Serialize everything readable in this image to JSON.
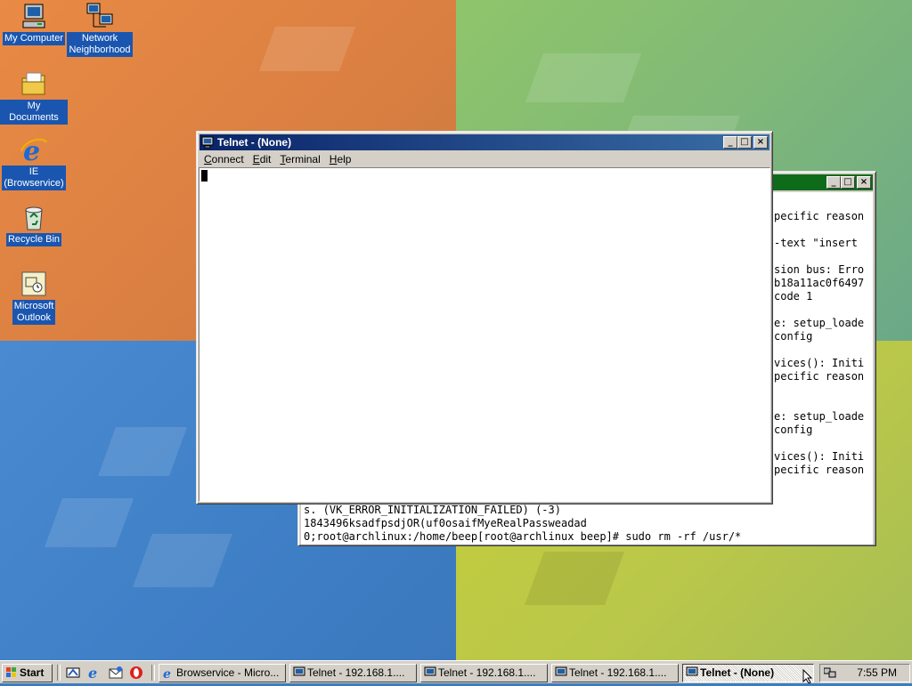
{
  "desktop": {
    "icons": [
      {
        "label_line1": "My Computer",
        "label_line2": ""
      },
      {
        "label_line1": "Network",
        "label_line2": "Neighborhood"
      },
      {
        "label_line1": "My Documents",
        "label_line2": ""
      },
      {
        "label_line1": "IE",
        "label_line2": "(Browservice)"
      },
      {
        "label_line1": "Recycle Bin",
        "label_line2": ""
      },
      {
        "label_line1": "Microsoft",
        "label_line2": "Outlook"
      }
    ]
  },
  "telnet_window": {
    "title": "Telnet - (None)",
    "menu": [
      "Connect",
      "Edit",
      "Terminal",
      "Help"
    ]
  },
  "background_terminal": {
    "lines_right": [
      "pecific reason",
      "",
      "-text \"insert",
      "",
      "sion bus: Erro",
      "b18a11ac0f6497",
      "code 1",
      "",
      "e: setup_loade",
      "config",
      "",
      "vices(): Initi",
      "pecific reason",
      "",
      "",
      "e: setup_loade",
      "config",
      "",
      "vices(): Initi",
      "pecific reason"
    ],
    "lines_bottom": [
      "s. (VK_ERROR_INITIALIZATION_FAILED) (-3)",
      "1843496ksadfpsdjOR(uf0osaifMyeRealPassweadad",
      "0;root@archlinux:/home/beep[root@archlinux beep]# sudo rm -rf /usr/*"
    ]
  },
  "taskbar": {
    "start_label": "Start",
    "buttons": [
      "Browservice - Micro...",
      "Telnet - 192.168.1....",
      "Telnet - 192.168.1....",
      "Telnet - 192.168.1....",
      "Telnet - (None)"
    ],
    "clock": "7:55 PM"
  },
  "colors": {
    "titlebar_active": "#0a246a",
    "titlebar_green": "#0e6b1a",
    "selection": "#1a56b0"
  }
}
